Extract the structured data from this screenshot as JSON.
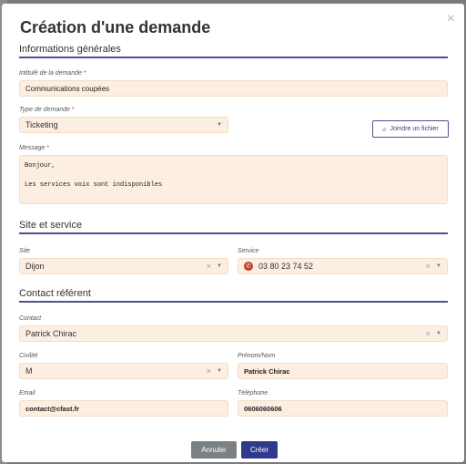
{
  "modal": {
    "title": "Création d'une demande",
    "close_icon": "×"
  },
  "sections": {
    "general": "Informations générales",
    "site": "Site et service",
    "contact": "Contact référent"
  },
  "form": {
    "intitule_label": "Intitulé de la demande",
    "intitule_value": "Communications coupées",
    "type_label": "Type de demande",
    "type_value": "Ticketing",
    "attach_label": "Joindre un fichier",
    "message_label": "Message",
    "message_value": "Bonjour,\n\nLes services voix sont indisponibles",
    "site_label": "Site",
    "site_value": "Dijon",
    "service_label": "Service",
    "service_value": "03 80 23 74 52",
    "contact_label": "Contact",
    "contact_value": "Patrick Chirac",
    "civilite_label": "Civilité",
    "civilite_value": "M",
    "prenom_label": "Prénom/Nom",
    "prenom_value": "Patrick Chirac",
    "email_label": "Email",
    "email_value": "contact@cfast.fr",
    "telephone_label": "Téléphone",
    "telephone_value": "0606060606"
  },
  "buttons": {
    "cancel": "Annuler",
    "create": "Créer"
  },
  "colors": {
    "accent": "#2f3a8a",
    "field_bg": "#fdeee2",
    "required": "#c0392b"
  }
}
